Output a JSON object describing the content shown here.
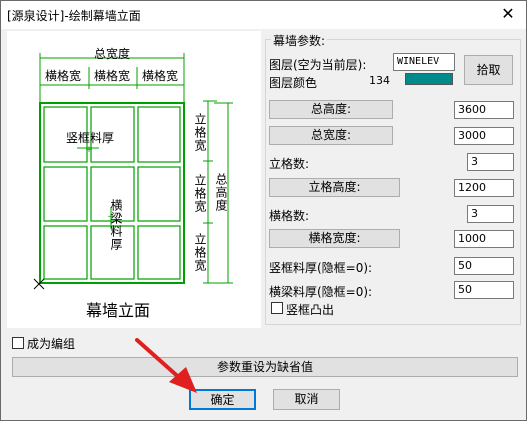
{
  "window": {
    "title": "[源泉设计]-绘制幕墙立面",
    "close_icon": "close-icon"
  },
  "preview": {
    "total_width": "总宽度",
    "mullion_width": "横格宽",
    "column_width": "立格宽",
    "total_height": "总高度",
    "vertical_frame_thickness": "竖框料厚",
    "horizontal_beam_thickness": "横梁料厚",
    "caption": "幕墙立面"
  },
  "params": {
    "group_title": "幕墙参数:",
    "layer_label": "图层(空为当前层):",
    "layer_value": "WINELEV",
    "layer_color_label": "图层颜色",
    "layer_color_number": "134",
    "layer_color_hex": "#008b8b",
    "pick_button": "拾取",
    "total_height_button": "总高度:",
    "total_height_value": "3600",
    "total_width_button": "总宽度:",
    "total_width_value": "3000",
    "column_count_label": "立格数:",
    "column_count_value": "3",
    "column_height_button": "立格高度:",
    "column_height_value": "1200",
    "row_count_label": "横格数:",
    "row_count_value": "3",
    "row_width_button": "横格宽度:",
    "row_width_value": "1000",
    "vframe_label": "竖框料厚(隐框=0):",
    "vframe_value": "50",
    "hbeam_label": "横梁料厚(隐框=0):",
    "hbeam_value": "50",
    "vframe_protrude_label": "竖框凸出"
  },
  "bottom": {
    "as_group_label": "成为编组",
    "reset_button": "参数重设为缺省值",
    "ok_button": "确定",
    "cancel_button": "取消"
  },
  "colors": {
    "diagram_line": "#00a000",
    "annotation_arrow": "#e02020"
  }
}
